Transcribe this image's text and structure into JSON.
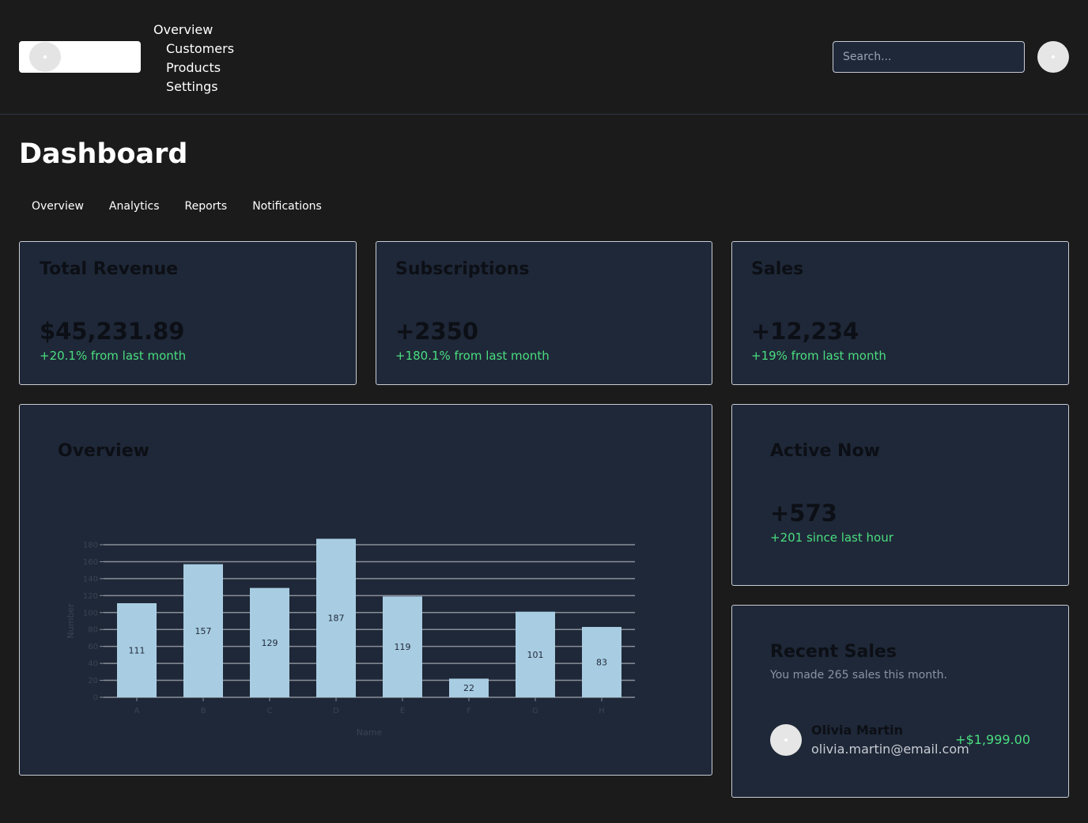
{
  "header": {
    "nav": [
      "Overview",
      "Customers",
      "Products",
      "Settings"
    ],
    "search_placeholder": "Search..."
  },
  "page": {
    "title": "Dashboard",
    "tabs": [
      "Overview",
      "Analytics",
      "Reports",
      "Notifications"
    ]
  },
  "stats": [
    {
      "title": "Total Revenue",
      "value": "$45,231.89",
      "change": "+20.1% from last month"
    },
    {
      "title": "Subscriptions",
      "value": "+2350",
      "change": "+180.1% from last month"
    },
    {
      "title": "Sales",
      "value": "+12,234",
      "change": "+19% from last month"
    }
  ],
  "overview": {
    "title": "Overview"
  },
  "active_now": {
    "title": "Active Now",
    "value": "+573",
    "change": "+201 since last hour"
  },
  "recent_sales": {
    "title": "Recent Sales",
    "subtitle": "You made 265 sales this month.",
    "items": [
      {
        "name": "Olivia Martin",
        "email": "olivia.martin@email.com",
        "amount": "+$1,999.00"
      }
    ]
  },
  "chart_data": {
    "type": "bar",
    "categories": [
      "A",
      "B",
      "C",
      "D",
      "E",
      "F",
      "G",
      "H"
    ],
    "values": [
      111,
      157,
      129,
      187,
      119,
      22,
      101,
      83
    ],
    "xlabel": "Name",
    "ylabel": "Number",
    "ylim": [
      0,
      180
    ],
    "yticks": [
      0,
      20,
      40,
      60,
      80,
      100,
      120,
      140,
      160,
      180
    ],
    "grid": true,
    "bar_color": "#a8cde2"
  },
  "colors": {
    "background": "#1b1b1b",
    "card": "#1f2838",
    "positive": "#4ade80"
  }
}
